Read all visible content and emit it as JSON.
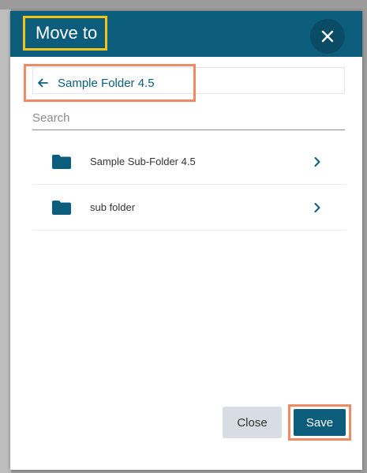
{
  "dialog": {
    "title": "Move to",
    "close_icon": "close-x-icon"
  },
  "breadcrumb": {
    "back_icon": "arrow-left-icon",
    "current_folder": "Sample Folder 4.5"
  },
  "search": {
    "placeholder": "Search",
    "value": ""
  },
  "folders": [
    {
      "label": "Sample Sub-Folder 4.5",
      "icon": "folder-icon",
      "chevron": "chevron-right-icon"
    },
    {
      "label": "sub folder",
      "icon": "folder-icon",
      "chevron": "chevron-right-icon"
    }
  ],
  "footer": {
    "close_label": "Close",
    "save_label": "Save"
  },
  "colors": {
    "header_bg": "#0c5d7c",
    "accent": "#0c5d7c",
    "close_button_bg": "#d8dde3",
    "title_highlight": "#f0c419",
    "callout_highlight": "#f08a63"
  }
}
